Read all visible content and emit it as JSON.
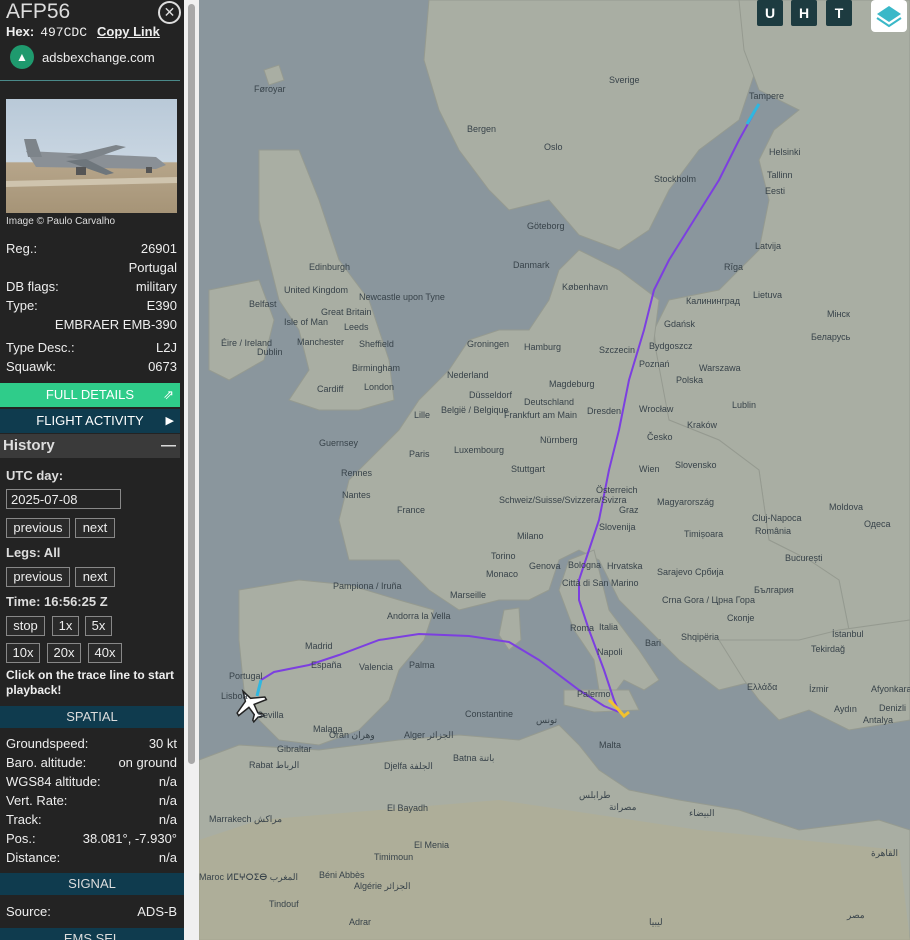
{
  "aircraft": {
    "callsign": "AFP56",
    "hex_label": "Hex:",
    "hex_value": "497CDC",
    "copy_link": "Copy Link",
    "source_site": "adsbexchange.com",
    "photo_credit": "Image © Paulo Carvalho"
  },
  "details": {
    "reg_label": "Reg.:",
    "reg_value": "26901",
    "country": "Portugal",
    "dbflags_label": "DB flags:",
    "dbflags_value": "military",
    "type_label": "Type:",
    "type_value": "E390",
    "type_full": "EMBRAER EMB-390",
    "typedesc_label": "Type Desc.:",
    "typedesc_value": "L2J",
    "squawk_label": "Squawk:",
    "squawk_value": "0673"
  },
  "buttons": {
    "full_details": "FULL DETAILS",
    "flight_activity": "FLIGHT ACTIVITY"
  },
  "history": {
    "title": "History",
    "utc_day_label": "UTC day:",
    "date": "2025-07-08",
    "previous": "previous",
    "next": "next",
    "legs_label": "Legs: All",
    "time_label": "Time: 16:56:25 Z",
    "stop": "stop",
    "speed_1x": "1x",
    "speed_5x": "5x",
    "speed_10x": "10x",
    "speed_20x": "20x",
    "speed_40x": "40x",
    "hint": "Click on the trace line to start playback!"
  },
  "spatial": {
    "title": "SPATIAL",
    "groundspeed_label": "Groundspeed:",
    "groundspeed_value": "30 kt",
    "baro_label": "Baro. altitude:",
    "baro_value": "on ground",
    "wgs_label": "WGS84 altitude:",
    "wgs_value": "n/a",
    "vrate_label": "Vert. Rate:",
    "vrate_value": "n/a",
    "track_label": "Track:",
    "track_value": "n/a",
    "pos_label": "Pos.:",
    "pos_value": "38.081°, -7.930°",
    "distance_label": "Distance:",
    "distance_value": "n/a"
  },
  "signal": {
    "title": "SIGNAL",
    "source_label": "Source:",
    "source_value": "ADS-B",
    "ems_title": "EMS SEL"
  },
  "map_buttons": {
    "u": "U",
    "h": "H",
    "t": "T"
  },
  "map_labels": {
    "faroyar": "Føroyar",
    "sverige": "Sverige",
    "bergen": "Bergen",
    "oslo": "Oslo",
    "stockholm": "Stockholm",
    "tampere": "Tampere",
    "helsinki": "Helsinki",
    "tallinn": "Tallinn",
    "eesti": "Eesti",
    "goteborg": "Göteborg",
    "latvija": "Latvija",
    "riga": "Rīga",
    "danmark": "Danmark",
    "kobenhavn": "København",
    "lietuva": "Lietuva",
    "edinburgh": "Edinburgh",
    "uk": "United Kingdom",
    "great_britain": "Great Britain",
    "belfast": "Belfast",
    "isle_of_man": "Isle of Man",
    "newcastle": "Newcastle upon Tyne",
    "eire": "Éire / Ireland",
    "dublin": "Dublin",
    "manchester": "Manchester",
    "leeds": "Leeds",
    "sheffield": "Sheffield",
    "birmingham": "Birmingham",
    "cardiff": "Cardiff",
    "london": "London",
    "hamburg": "Hamburg",
    "szczecin": "Szczecin",
    "gdansk": "Gdańsk",
    "bydgoszcz": "Bydgoszcz",
    "kaliningrad": "Калининград",
    "nederland": "Nederland",
    "groningen": "Groningen",
    "poznan": "Poznań",
    "polska": "Polska",
    "warszawa": "Warszawa",
    "belarus": "Беларусь",
    "minsk": "Мінск",
    "magdeburg": "Magdeburg",
    "deutschland": "Deutschland",
    "dusseldorf": "Düsseldorf",
    "frankfurt": "Frankfurt am Main",
    "dresden": "Dresden",
    "wroclaw": "Wrocław",
    "krakow": "Kraków",
    "lublin": "Lublin",
    "lille": "Lille",
    "belgie": "België / Belgique",
    "luxembourg": "Luxembourg",
    "nurnberg": "Nürnberg",
    "cesko": "Česko",
    "slovensko": "Slovensko",
    "wien": "Wien",
    "guernsey": "Guernsey",
    "paris": "Paris",
    "rennes": "Rennes",
    "nantes": "Nantes",
    "france": "France",
    "stuttgart": "Stuttgart",
    "schweiz": "Schweiz/Suisse/Svizzera/Svizra",
    "osterreich": "Österreich",
    "graz": "Graz",
    "magyarorszag": "Magyarország",
    "milano": "Milano",
    "torino": "Torino",
    "slovenija": "Slovenija",
    "hrvatska": "Hrvatska",
    "romania": "România",
    "timisoara": "Timișoara",
    "cluj": "Cluj-Napoca",
    "bucuresti": "București",
    "moldova": "Moldova",
    "odesa": "Одеса",
    "genova": "Genova",
    "monaco": "Monaco",
    "marseille": "Marseille",
    "bologna": "Bologna",
    "san_marino": "Città di San Marino",
    "italia": "Italia",
    "roma": "Roma",
    "napoli": "Napoli",
    "bari": "Bari",
    "sarajevo": "Sarajevo",
    "srbija": "Србија",
    "crna_gora": "Crna Gora / Црна Гора",
    "shqiperia": "Shqipëria",
    "bulgaria": "България",
    "skopje": "Скопје",
    "istanbul": "İstanbul",
    "tekirdag": "Tekirdağ",
    "ellada": "Ελλάδα",
    "izmir": "İzmir",
    "afyonkarahisar": "Afyonkarahisar",
    "aydin": "Aydın",
    "denizli": "Denizli",
    "antalya": "Antalya",
    "pamplona": "Pampiona / Iruña",
    "andorra": "Andorra la Vella",
    "espana": "España",
    "madrid": "Madrid",
    "valencia": "Valencia",
    "palma": "Palma",
    "portugal": "Portugal",
    "lisboa": "Lisboa",
    "sevilla": "Sevilla",
    "malaga": "Malaga",
    "gibraltar": "Gibraltar",
    "palermo": "Palermo",
    "malta": "Malta",
    "constantine": "Constantine",
    "tunis": "تونس",
    "alger": "Alger الجزائر",
    "oran": "Oran وهران",
    "djelfa": "Djelfa الجلفة",
    "batna": "Batna باتنة",
    "rabat": "Rabat الرباط",
    "marrakech": "Marrakech مراكش",
    "algerie": "Algérie الجزائر",
    "tripoli": "طرابلس",
    "misrata": "مصراتة",
    "bayda": "البيضاء",
    "al_qahira": "القاهرة",
    "misr": "مصر",
    "libya": "ليبيا",
    "el_bayadh": "El Bayadh",
    "el_menia": "El Menia",
    "timimoun": "Timimoun",
    "beni_abbes": "Béni Abbès",
    "tindouf": "Tindouf",
    "adrar": "Adrar",
    "maroc": "Maroc ⵍⵎⵖⵔⵉⴱ المغرب"
  }
}
